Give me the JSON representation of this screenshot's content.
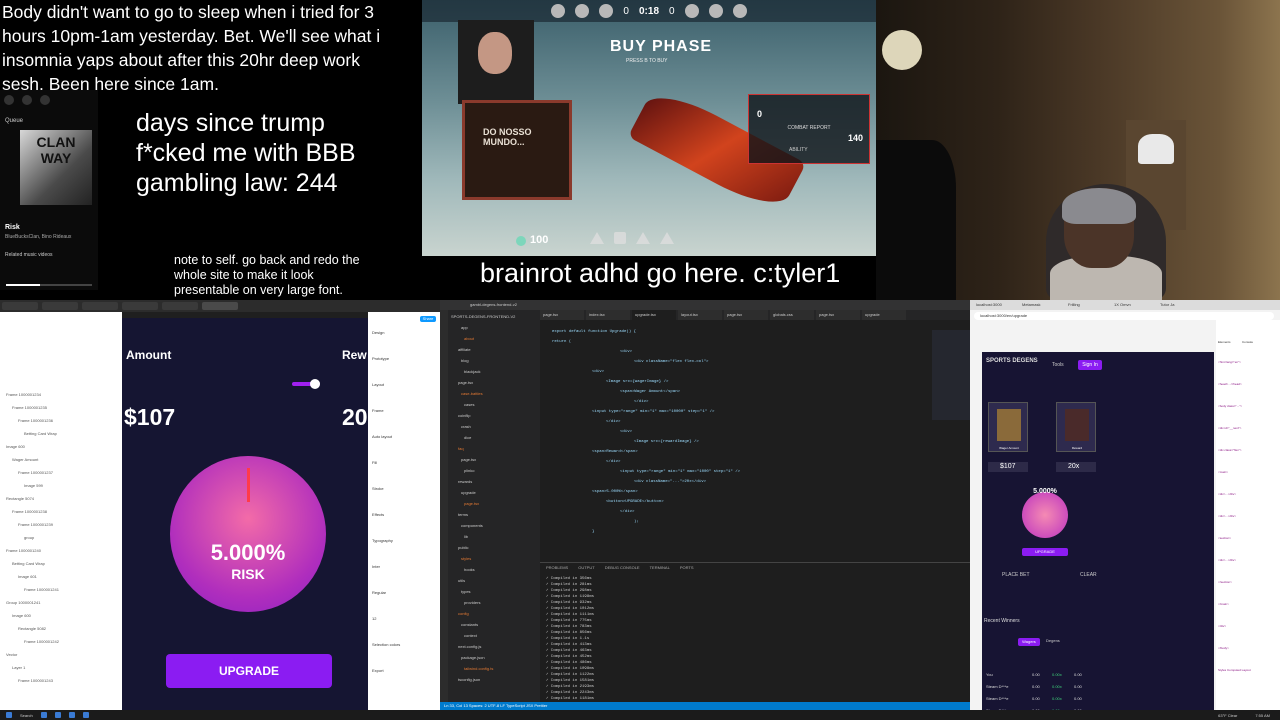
{
  "overlay": {
    "note_top": "Body didn't want to go to sleep when i tried for 3 hours 10pm-1am yesterday. Bet. We'll see what i insomnia yaps about after this 20hr deep work sesh. Been here since 1am.",
    "days_since": "days since trump f*cked me with BBB gambling law: 244",
    "note_self": "note to self. go back and redo the whole site to make it look presentable on very large font.",
    "brainrot": "brainrot adhd go here. c:tyler1"
  },
  "spotify": {
    "queue_label": "Queue",
    "album_text": "CLAN WAY",
    "track": "Risk",
    "artist": "BlueBucksClan, Bino Rideaux",
    "related": "Related music videos"
  },
  "game": {
    "timer": "0:18",
    "score_left": "0",
    "score_right": "0",
    "buy_phase": "BUY PHASE",
    "buy_sub": "PRESS B TO BUY",
    "banner_text": "DO NOSSO MUNDO...",
    "combat_report": "COMBAT REPORT",
    "combat_kills": "0",
    "combat_hp": "140",
    "ability_label": "ABILITY",
    "health": "100",
    "ability_key": "5"
  },
  "figma": {
    "amount_label": "Amount",
    "reward_label": "Rew",
    "amount_value": "$107",
    "reward_value": "20",
    "percent": "5.000%",
    "risk": "RISK",
    "upgrade": "UPGRADE",
    "share": "Share",
    "layers": [
      "Frame 1000001234",
      "Frame 1000001235",
      "Frame 1000001236",
      "Betting Card Wrap",
      "Image 600",
      "Wager Amount",
      "Frame 1000001237",
      "Image 599",
      "Rectangle 5074",
      "Frame 1000001238",
      "Frame 1000001239",
      "group",
      "Frame 1000001240",
      "Betting Card Wrap",
      "Image 601",
      "Frame 1000001241",
      "Group 1000001241",
      "Image 600",
      "Rectangle 5082",
      "Frame 1000001242",
      "Vector",
      "Layer 1",
      "Frame 1000001243"
    ],
    "props": [
      "Design",
      "Prototype",
      "Layout",
      "Frame",
      "Auto layout",
      "Fill",
      "Stroke",
      "Effects",
      "Typography",
      "Inter",
      "Regular",
      "12",
      "Selection colors",
      "Export"
    ]
  },
  "vscode": {
    "title": "gambl-degens-frontend-v2",
    "tabs": [
      "page.tsx",
      "index.tsx",
      "upgrade.tsx",
      "layout.tsx",
      "page.tsx",
      "globals.css",
      "page.tsx",
      "upgrade"
    ],
    "files": [
      "SPORTS-DEGENS-FRONTEND-V2",
      "app",
      "about",
      "affiliate",
      "blog",
      "blackjack",
      "page.tsx",
      "case-battles",
      "cases",
      "coinflip",
      "crash",
      "dice",
      "faq",
      "page.tsx",
      "plinko",
      "rewards",
      "upgrade",
      "page.tsx",
      "terms",
      "components",
      "lib",
      "public",
      "styles",
      "hooks",
      "utils",
      "types",
      "providers",
      "config",
      "constants",
      "context",
      "next.config.js",
      "package.json",
      "tailwind.config.ts",
      "tsconfig.json"
    ],
    "code_lines": [
      "export default function Upgrade() {",
      "  return (",
      "    <div>",
      "      <div className=\"flex flex-col\">",
      "        <div>",
      "          <Image src={wagerImage} />",
      "          <span>Wager Amount</span>",
      "        </div>",
      "        <input type=\"range\" min=\"1\" max=\"10000\" step=\"1\" />",
      "      </div>",
      "      <div>",
      "        <Image src={rewardImage} />",
      "        <span>Reward</span>",
      "      </div>",
      "      <input type=\"range\" min=\"1\" max=\"1000\" step=\"1\" />",
      "      <div className=\"...\">20x</div>",
      "      <span>5.000%</span>",
      "      <button>UPGRADE</button>",
      "    </div>",
      "  );",
      "}"
    ],
    "term_tabs": [
      "PROBLEMS",
      "OUTPUT",
      "DEBUG CONSOLE",
      "TERMINAL",
      "PORTS"
    ],
    "term_lines": [
      "✓ Compiled in 356ms",
      "✓ Compiled in 281ms",
      "✓ Compiled in 298ms",
      "✓ Compiled in 1198ms",
      "✓ Compiled in 932ms",
      "✓ Compiled in 1012ms",
      "✓ Compiled in 1111ms",
      "✓ Compiled in 775ms",
      "✓ Compiled in 783ms",
      "✓ Compiled in 856ms",
      "✓ Compiled in 1.1s",
      "✓ Compiled in 413ms",
      "✓ Compiled in 463ms",
      "✓ Compiled in 452ms",
      "✓ Compiled in 486ms",
      "✓ Compiled in 1098ms",
      "✓ Compiled in 1122ms",
      "✓ Compiled in 1581ms",
      "✓ Compiled in 2193ms",
      "✓ Compiled in 2243ms",
      "✓ Compiled in 1181ms"
    ],
    "status": "Ln 33, Col 13  Spaces: 2  UTF-8  LF  TypeScript JSX  Prettier"
  },
  "browser": {
    "tabs": [
      "localhost:3000",
      "Metamask",
      "Frilling",
      "1X Omvn",
      "Tutor Ja"
    ],
    "url": "localhost:3000/en/upgrade",
    "logo": "SPORTS DEGENS",
    "nav_tools": "Tools",
    "signin": "Sign In",
    "wager_card": "Wager Amount",
    "reward_card": "Reward",
    "amount": "$107",
    "multiplier": "20x",
    "percent": "5.000%",
    "upgrade": "UPGRADE",
    "place_bet": "PLACE BET",
    "clear": "CLEAR",
    "recent_winners": "Recent Winners",
    "wagers_tab": "Wagers",
    "degens_tab": "Degens",
    "rows": [
      {
        "player": "You",
        "wager": "0.00",
        "multiplier": "0.00x",
        "cashout": "0.00"
      },
      {
        "player": "Steam D***e",
        "wager": "0.00",
        "multiplier": "0.00x",
        "cashout": "0.00"
      },
      {
        "player": "Steam D***e",
        "wager": "0.00",
        "multiplier": "0.00x",
        "cashout": "0.00"
      },
      {
        "player": "Steam D***e",
        "wager": "0.00",
        "multiplier": "0.00x",
        "cashout": "0.00"
      }
    ],
    "devtools_tabs": [
      "Elements",
      "Console"
    ],
    "devtools_lines": [
      "<html lang=\"en\">",
      "<head>...</head>",
      "<body class=\"...\">",
      "<div id=\"__next\">",
      "<div class=\"flex\">",
      "<main>",
      "<div>...</div>",
      "<div>...</div>",
      "<section>",
      "<div>...</div>",
      "</section>",
      "</main>",
      "</div>",
      "</body>",
      "Styles  Computed  Layout"
    ]
  },
  "taskbar": {
    "search": "Search",
    "weather": "63°F Clear",
    "time": "7:55 AM"
  }
}
